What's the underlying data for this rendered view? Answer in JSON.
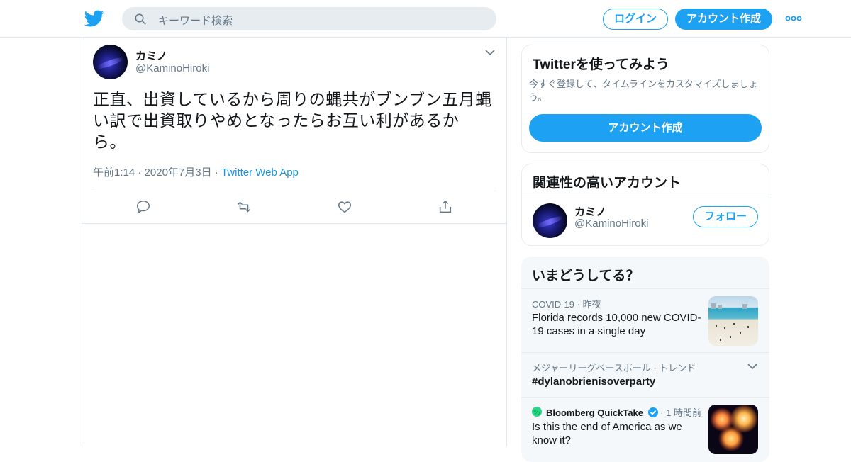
{
  "header": {
    "search_placeholder": "キーワード検索",
    "login_label": "ログイン",
    "signup_label": "アカウント作成"
  },
  "tweet": {
    "name": "カミノ",
    "handle": "@KaminoHiroki",
    "text_line1": "正直、出資しているから周りの蝿共がブンブン五月蝿",
    "text_line2": "い訳で出資取りやめとなったらお互い利があるか",
    "text_line3": "ら。",
    "time": "午前1:14",
    "date": "2020年7月3日",
    "source": "Twitter Web App"
  },
  "signup_card": {
    "title": "Twitterを使ってみよう",
    "subtitle": "今すぐ登録して、タイムラインをカスタマイズしましょう。",
    "button_label": "アカウント作成"
  },
  "related": {
    "title": "関連性の高いアカウント",
    "name": "カミノ",
    "handle": "@KaminoHiroki",
    "follow_label": "フォロー"
  },
  "trends": {
    "title": "いまどうしてる？",
    "items": [
      {
        "category": "COVID-19",
        "time": "昨夜",
        "headline": "Florida records 10,000 new COVID-19 cases in a single day",
        "headline_l1": "Florida records 10,000 new COVID-",
        "headline_l2": "19 cases in a single day"
      },
      {
        "category": "メジャーリーグベースボール",
        "time": "トレンド",
        "headline": "#dylanobrienisoverparty"
      },
      {
        "category": "Bloomberg QuickTake",
        "time": "1 時間前",
        "headline_l1": "Is this the end of America as we",
        "headline_l2": "know it?"
      }
    ]
  },
  "colors": {
    "accent": "#1da1f2",
    "text": "#14171a",
    "secondary": "#657786",
    "border": "#e1e8ed"
  }
}
